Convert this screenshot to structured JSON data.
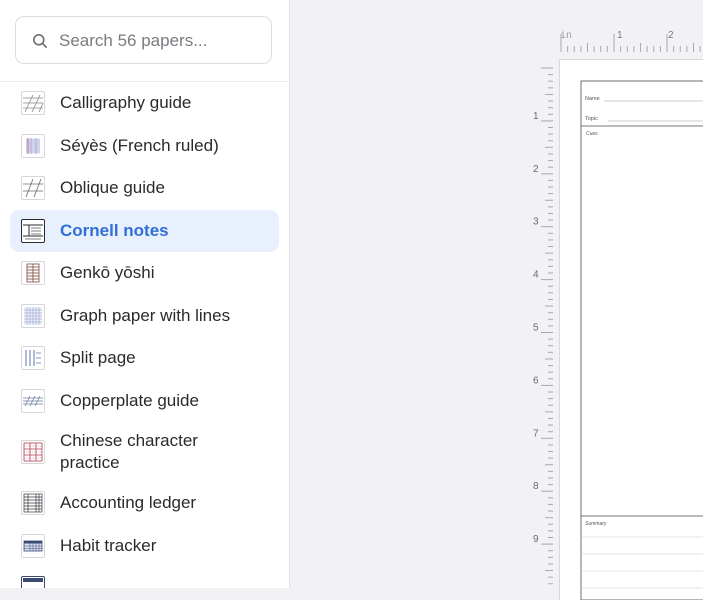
{
  "search": {
    "placeholder": "Search 56 papers..."
  },
  "papers": [
    {
      "label": "Calligraphy guide",
      "icon": "calligraphy-thumb-icon"
    },
    {
      "label": "Séyès (French ruled)",
      "icon": "seyes-thumb-icon"
    },
    {
      "label": "Oblique guide",
      "icon": "oblique-thumb-icon"
    },
    {
      "label": "Cornell notes",
      "icon": "cornell-thumb-icon",
      "active": true
    },
    {
      "label": "Genkō yōshi",
      "icon": "genko-thumb-icon"
    },
    {
      "label": "Graph paper with lines",
      "icon": "graph-thumb-icon"
    },
    {
      "label": "Split page",
      "icon": "split-thumb-icon"
    },
    {
      "label": "Copperplate guide",
      "icon": "copperplate-thumb-icon"
    },
    {
      "label": "Chinese character practice",
      "icon": "chinese-thumb-icon"
    },
    {
      "label": "Accounting ledger",
      "icon": "ledger-thumb-icon"
    },
    {
      "label": "Habit tracker",
      "icon": "habit-thumb-icon"
    }
  ],
  "ruler": {
    "unit": "in",
    "top_ticks": [
      "1",
      "2"
    ],
    "left_ticks": [
      "1",
      "2",
      "3",
      "4",
      "5",
      "6",
      "7",
      "8",
      "9"
    ]
  },
  "page": {
    "name_label": "Name",
    "topic_label": "Topic",
    "cues_label": "Cues",
    "summary_label": "Summary"
  },
  "colors": {
    "accent": "#2f6fd6",
    "active_bg": "#e8f0fd",
    "canvas_bg": "#f2f2f4"
  }
}
